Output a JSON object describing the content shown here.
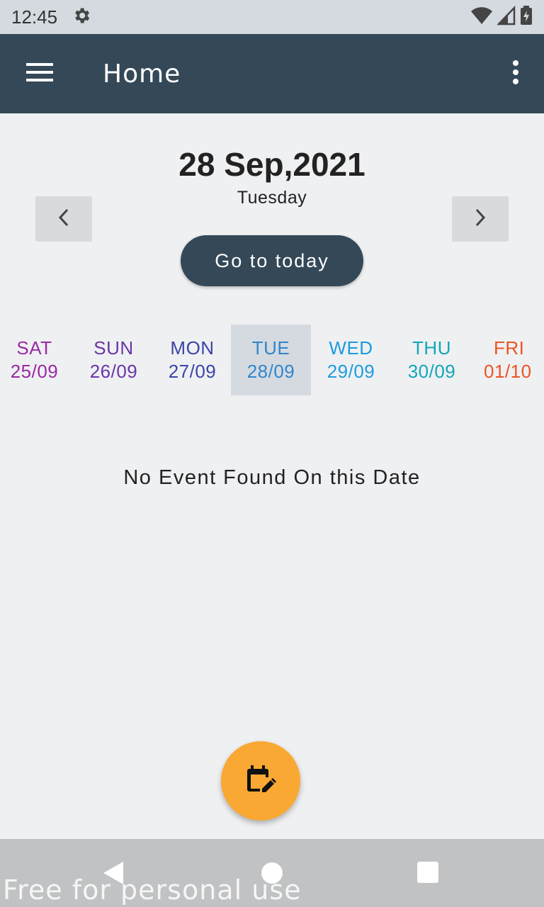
{
  "status_bar": {
    "time": "12:45",
    "icons": [
      "settings-icon",
      "wifi-icon",
      "signal-icon",
      "battery-charging-icon"
    ]
  },
  "app_bar": {
    "title": "Home",
    "menu_icon": "hamburger-menu-icon",
    "more_icon": "more-vert-icon",
    "background": "#344857"
  },
  "date_header": {
    "date": "28 Sep,2021",
    "weekday": "Tuesday",
    "prev_icon": "chevron-left-icon",
    "next_icon": "chevron-right-icon",
    "today_label": "Go to today"
  },
  "days": [
    {
      "name": "SAT",
      "date": "25/09",
      "color": "#9b2aa5"
    },
    {
      "name": "SUN",
      "date": "26/09",
      "color": "#6a36a8"
    },
    {
      "name": "MON",
      "date": "27/09",
      "color": "#3b45a6"
    },
    {
      "name": "TUE",
      "date": "28/09",
      "color": "#2f86cf",
      "selected": true
    },
    {
      "name": "WED",
      "date": "29/09",
      "color": "#1c9be0"
    },
    {
      "name": "THU",
      "date": "30/09",
      "color": "#12a7b9"
    },
    {
      "name": "FRI",
      "date": "01/10",
      "color": "#ec5524"
    }
  ],
  "empty_message": "No Event Found On this Date",
  "fab": {
    "icon": "calendar-edit-icon",
    "color": "#f9a933"
  },
  "system_nav": {
    "icons": [
      "back-icon",
      "home-icon",
      "recents-icon"
    ]
  },
  "watermark": "Free for personal use"
}
